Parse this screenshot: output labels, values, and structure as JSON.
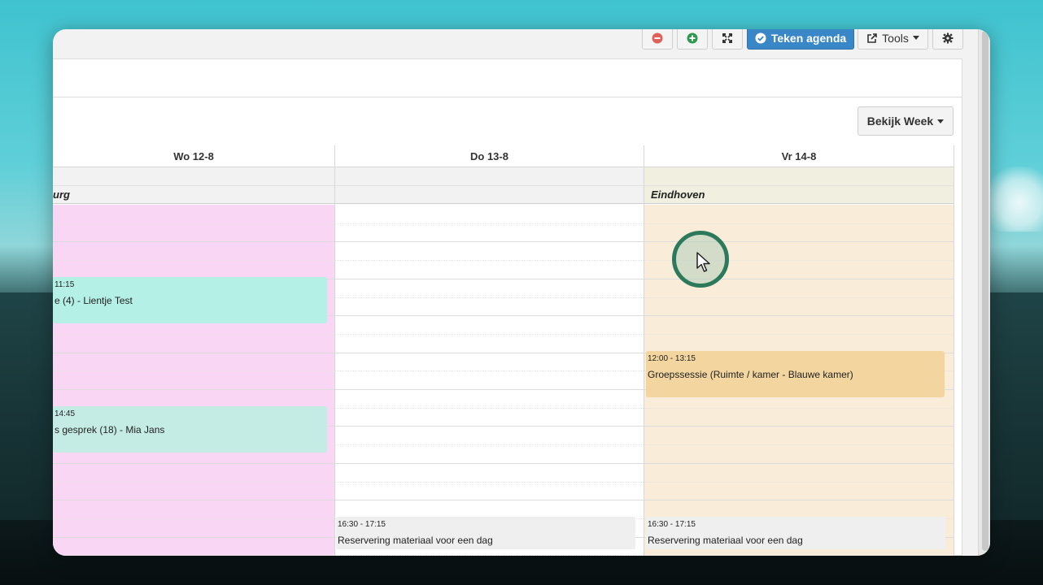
{
  "toolbar": {
    "remove_icon": "minus-circle-icon",
    "add_icon": "plus-circle-icon",
    "fullscreen_icon": "expand-icon",
    "sign_label": "Teken agenda",
    "tools_label": "Tools",
    "settings_icon": "gear-icon"
  },
  "view": {
    "week_button_label": "Bekijk Week"
  },
  "calendar": {
    "days": [
      {
        "label": "Wo 12-8",
        "location": "urg"
      },
      {
        "label": "Do 13-8",
        "location": ""
      },
      {
        "label": "Vr 14-8",
        "location": "Eindhoven"
      }
    ],
    "events": {
      "wo_1": {
        "time": "11:15",
        "title": "e (4) - Lientje Test"
      },
      "wo_2": {
        "time": "14:45",
        "title": "s gesprek (18) - Mia Jans"
      },
      "vr_1": {
        "time": "12:00 - 13:15",
        "title": "Groepssessie (Ruimte / kamer - Blauwe kamer)"
      },
      "do_bottom": {
        "time": "16:30 - 17:15",
        "title": "Reservering materiaal voor een dag"
      },
      "vr_bottom": {
        "time": "16:30 - 17:15",
        "title": "Reservering materiaal voor een dag"
      }
    }
  },
  "colors": {
    "wo_bg": "#f8d6f4",
    "vr_bg": "#f9ecd8",
    "event_teal": "#b4f0e6",
    "event_teal2": "#c4ece4",
    "event_orange": "#f3d59f",
    "event_grey": "#efefef",
    "primary": "#3a87c8"
  }
}
